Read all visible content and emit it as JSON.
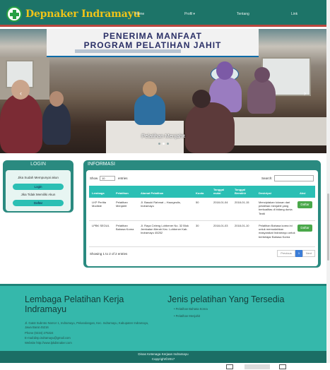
{
  "brand": {
    "name": "Depnaker Indramayu"
  },
  "nav": {
    "items": [
      {
        "label": "Home"
      },
      {
        "label": "Profil"
      },
      {
        "label": "Tentang"
      },
      {
        "label": "Link"
      }
    ],
    "profil_caret": "▾"
  },
  "hero": {
    "banner_line1": "PENERIMA MANFAAT",
    "banner_line2": "PROGRAM PELATIHAN JAHIT",
    "banner_logo": "KKN",
    "caption": "Pelatihan Menjahit"
  },
  "login": {
    "title": "LOGIN",
    "has_account_text": "Jika Sudah Mempunyai akun",
    "login_button": "Login",
    "no_account_text": "Jika Tidak Memiliki Akun",
    "register_button": "Daftar"
  },
  "info": {
    "title": "INFORMASI",
    "show_label": "Show",
    "entries_value": "10",
    "entries_label": "entries",
    "search_label": "Search:",
    "columns": [
      "Lembaga",
      "Pelatihan",
      "Alamat Pelatihan",
      "Kuota",
      "Tanggal mulai",
      "Tanggal Berakhir",
      "Deskripsi",
      "Aksi"
    ],
    "rows": [
      {
        "lembaga": "LKP Perlita Modiste",
        "pelatihan": "Pelatihan Menjahit",
        "alamat": "Jl. Basuki Rahmat – Haurgeulis, Indramayu",
        "kuota": "50",
        "mulai": "2018-01-04",
        "berakhir": "2018-01-15",
        "deskripsi": "Menciptakan lulusan dari pelatihan menjahit yang berkualitas di bidang dunia Textil",
        "aksi": "Daftar"
      },
      {
        "lembaga": "LPBK SEOUL",
        "pelatihan": "Pelatihan Bahasa Korea",
        "alamat": "Jl. Raya Celeng Lohbener No. 32 Blok Jembatan Merah Kec. Lohbener Kab. Indramayu 45252",
        "kuota": "30",
        "mulai": "2018-01-03",
        "berakhir": "2018-01-10",
        "deskripsi": "Pelatihan Bahasa korea ini untuk memudahkan masyarakat Indramayu untuk berbelajar Bahasa Korea",
        "aksi": "Daftar"
      }
    ],
    "showing_text": "Showing 1 to 2 of 2 entries",
    "pager": {
      "previous": "Previous",
      "page": "1",
      "next": "Next"
    }
  },
  "footer": {
    "left_title": "Lembaga Pelatihan Kerja Indramayu",
    "address": "Jl. Gatot Subroto Nomor 1, Indramayu, Pekandangan, Kec. Indramayu, Kabupaten Indramayu, Jawa Barat 45216",
    "phone": "Phone (0234) 275324",
    "email": "E-mail:disp.indramayu@gmail.com",
    "website": "Website http://www.lpkdisnaker.com",
    "right_title": "Jenis pelatihan Yang Tersedia",
    "list": [
      "Pelatihan Bahasa Korea",
      "Pelatihan Menjahit"
    ],
    "copyright_line1": "Dinas Ketenaga Kerjaan Indramayu",
    "copyright_line2": "Copyright©2017"
  },
  "colors": {
    "navbar": "#1d7468",
    "accent": "#2bbfb4",
    "footer": "#35b8ab",
    "brand_text": "#f0c419"
  }
}
